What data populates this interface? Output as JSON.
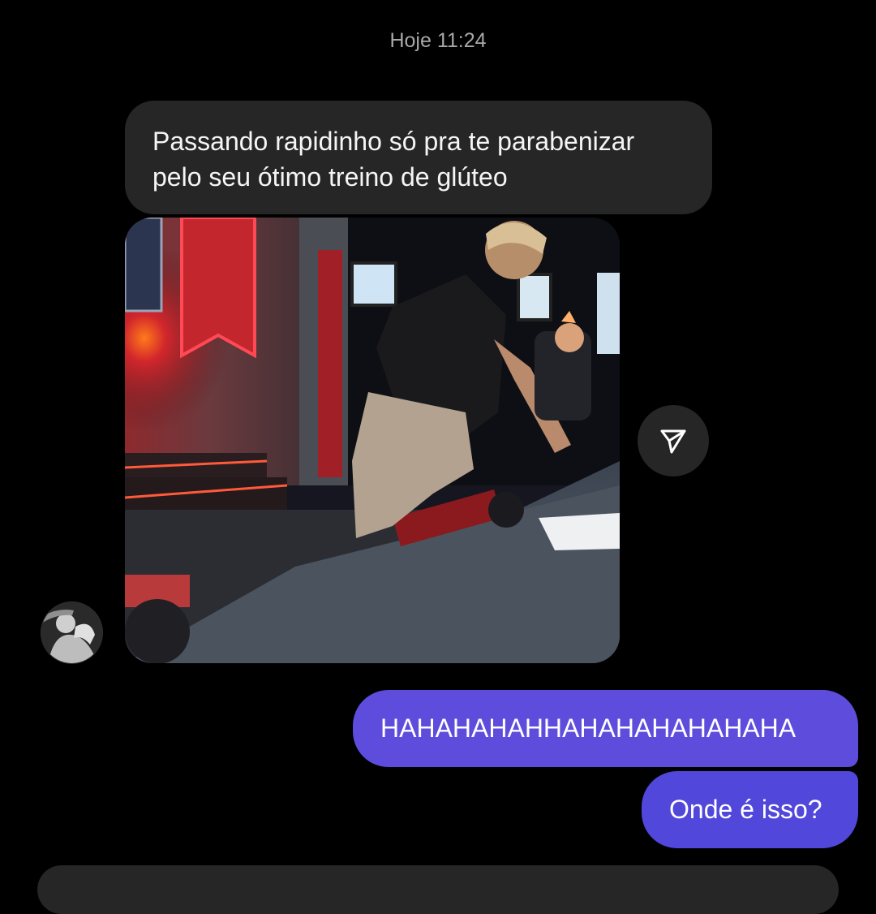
{
  "thread": {
    "timestamp": "Hoje 11:24"
  },
  "messages": {
    "incoming_text": "Passando rapidinho só pra te parabenizar pelo seu ótimo treino de glúteo",
    "outgoing": [
      "HAHAHAHAHHAHAHAHAHAHAHA",
      "Onde é isso?"
    ]
  },
  "media": {
    "type": "shared-video"
  },
  "icons": {
    "share": "send-icon",
    "avatar": "contact-avatar"
  },
  "colors": {
    "background": "#000000",
    "incoming_bubble": "#262626",
    "outgoing_bubble": "#5b4fe0",
    "timestamp": "#a8a8a8"
  }
}
